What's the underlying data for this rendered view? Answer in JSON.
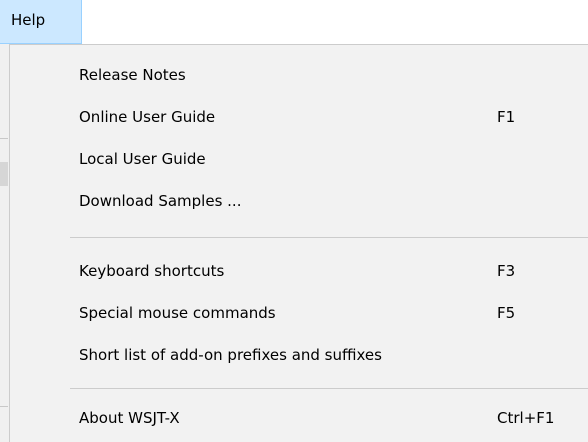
{
  "menubar": {
    "help_label": "Help"
  },
  "menu": {
    "items": [
      {
        "label": "Release Notes",
        "shortcut": ""
      },
      {
        "label": "Online User Guide",
        "shortcut": "F1"
      },
      {
        "label": "Local User Guide",
        "shortcut": ""
      },
      {
        "label": "Download Samples ...",
        "shortcut": ""
      },
      {
        "label": "Keyboard shortcuts",
        "shortcut": "F3"
      },
      {
        "label": "Special mouse commands",
        "shortcut": "F5"
      },
      {
        "label": "Short list of add-on prefixes and suffixes",
        "shortcut": ""
      },
      {
        "label": "About WSJT-X",
        "shortcut": "Ctrl+F1"
      }
    ]
  },
  "colors": {
    "menubar_highlight": "#cce8ff",
    "menu_background": "#f2f2f2",
    "separator": "#cccccc"
  }
}
